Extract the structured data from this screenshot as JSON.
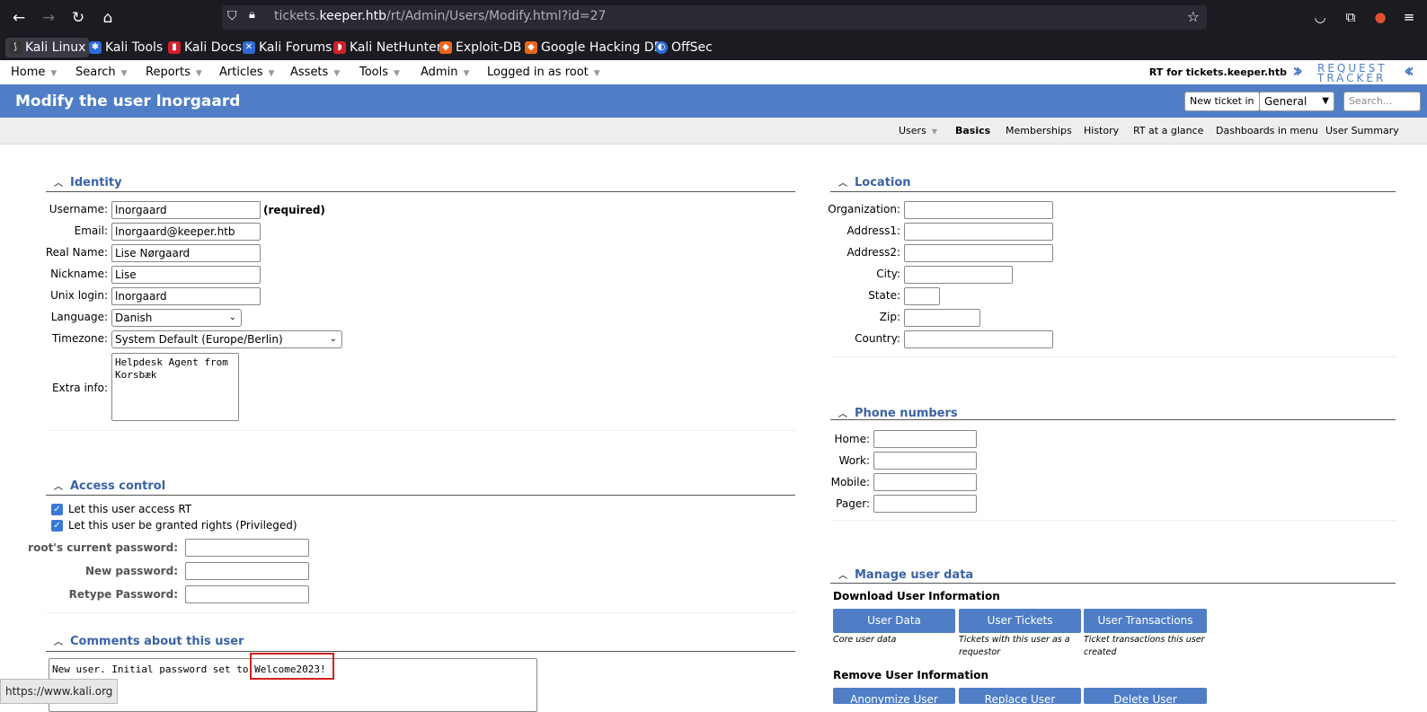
{
  "browser": {
    "url_prefix": "tickets.",
    "url_domain": "keeper.htb",
    "url_path": "/rt/Admin/Users/Modify.html?id=27",
    "bookmarks": [
      "Kali Linux",
      "Kali Tools",
      "Kali Docs",
      "Kali Forums",
      "Kali NetHunter",
      "Exploit-DB",
      "Google Hacking DB",
      "OffSec"
    ],
    "status_url": "https://www.kali.org"
  },
  "topmenu": {
    "items": [
      "Home",
      "Search",
      "Reports",
      "Articles",
      "Assets",
      "Tools",
      "Admin",
      "Logged in as root"
    ],
    "rt_for": "RT for tickets.keeper.htb",
    "logo_line1": "REQUEST",
    "logo_line2": "TRACKER"
  },
  "header": {
    "title": "Modify the user lnorgaard",
    "new_ticket": "New ticket in",
    "queue": "General",
    "search_placeholder": "Search..."
  },
  "subnav": [
    "Users",
    "Basics",
    "Memberships",
    "History",
    "RT at a glance",
    "Dashboards in menu",
    "User Summary"
  ],
  "identity": {
    "title": "Identity",
    "username_label": "Username:",
    "username": "lnorgaard",
    "required": "(required)",
    "email_label": "Email:",
    "email": "lnorgaard@keeper.htb",
    "realname_label": "Real Name:",
    "realname": "Lise Nørgaard",
    "nickname_label": "Nickname:",
    "nickname": "Lise",
    "unix_label": "Unix login:",
    "unix": "lnorgaard",
    "language_label": "Language:",
    "language": "Danish",
    "timezone_label": "Timezone:",
    "timezone": "System Default (Europe/Berlin)",
    "extra_label": "Extra info:",
    "extra": "Helpdesk Agent from\nKorsbæk"
  },
  "access": {
    "title": "Access control",
    "cb1": "Let this user access RT",
    "cb2": "Let this user be granted rights (Privileged)",
    "cur_pw_label": "root's current password:",
    "new_pw_label": "New password:",
    "retype_label": "Retype Password:"
  },
  "comments": {
    "title": "Comments about this user",
    "text_prefix": "New user. Initial password set to ",
    "password": "Welcome2023!"
  },
  "location": {
    "title": "Location",
    "labels": [
      "Organization:",
      "Address1:",
      "Address2:",
      "City:",
      "State:",
      "Zip:",
      "Country:"
    ]
  },
  "phones": {
    "title": "Phone numbers",
    "labels": [
      "Home:",
      "Work:",
      "Mobile:",
      "Pager:"
    ]
  },
  "manage": {
    "title": "Manage user data",
    "download_head": "Download User Information",
    "btn_user_data": "User Data",
    "desc_user_data": "Core user data",
    "btn_user_tickets": "User Tickets",
    "desc_user_tickets": "Tickets with this user as a requestor",
    "btn_user_trans": "User Transactions",
    "desc_user_trans": "Ticket transactions this user created",
    "remove_head": "Remove User Information",
    "btn_anon": "Anonymize User",
    "btn_replace": "Replace User",
    "btn_delete": "Delete User"
  }
}
